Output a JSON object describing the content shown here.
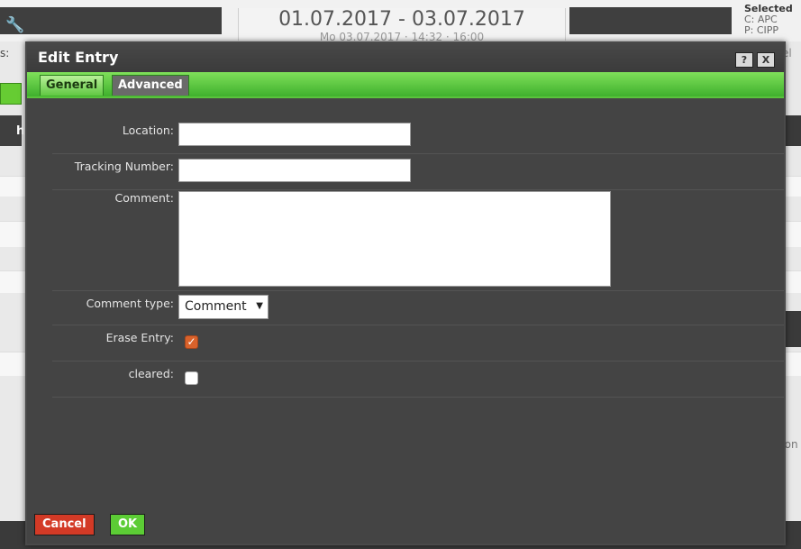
{
  "background": {
    "date_range": "01.07.2017 - 03.07.2017",
    "date_subtitle": "Mo 03.07.2017 · 14:32 · 16:00",
    "selected_label": "Selected",
    "selected_c": "C: APC",
    "selected_p": "P: CIPP",
    "left_fragment": "s:",
    "right_fragment_top": "el",
    "right_fragment_con": "con",
    "left_h": "h"
  },
  "dialog": {
    "title": "Edit Entry",
    "help_label": "?",
    "close_label": "X",
    "tabs": {
      "general": "General",
      "advanced": "Advanced"
    },
    "fields": {
      "location_label": "Location:",
      "location_value": "",
      "tracking_label": "Tracking Number:",
      "tracking_value": "",
      "comment_label": "Comment:",
      "comment_value": "",
      "comment_type_label": "Comment type:",
      "comment_type_value": "Comment",
      "erase_label": "Erase Entry:",
      "erase_checked": true,
      "cleared_label": "cleared:",
      "cleared_checked": false
    },
    "buttons": {
      "cancel": "Cancel",
      "ok": "OK"
    }
  },
  "colors": {
    "dialog_bg": "#444444",
    "tab_green": "#5ac33c",
    "cancel_red": "#d33a26",
    "ok_green": "#5ccc35",
    "checkbox_orange": "#d9622b"
  }
}
